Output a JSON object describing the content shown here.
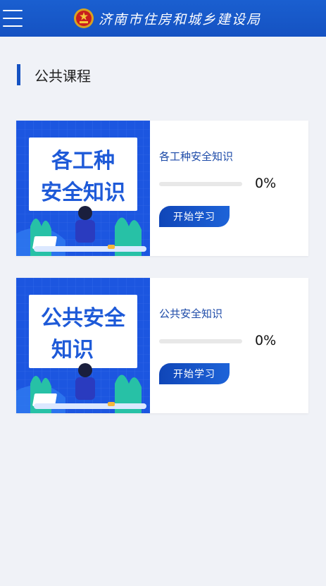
{
  "header": {
    "title": "济南市住房和城乡建设局",
    "menu_icon": "hamburger-menu-icon",
    "emblem_icon": "national-emblem-icon",
    "brand_color": "#1552c2"
  },
  "section": {
    "title": "公共课程"
  },
  "courses": [
    {
      "thumbnail_lines": [
        "各工种",
        "安全知识"
      ],
      "name": "各工种安全知识",
      "progress_text": "0%",
      "progress_value": 0,
      "button_label": "开始学习"
    },
    {
      "thumbnail_lines": [
        "公共安全",
        "知识"
      ],
      "name": "公共安全知识",
      "progress_text": "0%",
      "progress_value": 0,
      "button_label": "开始学习"
    }
  ]
}
